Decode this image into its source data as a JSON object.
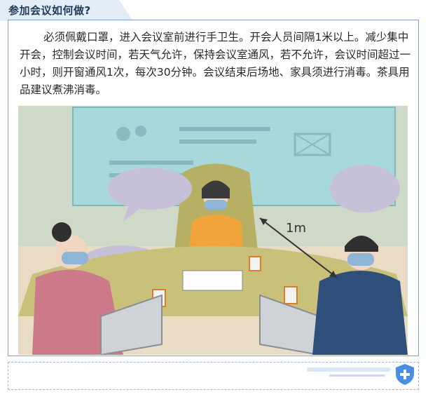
{
  "header": {
    "title": "参加会议如何做?"
  },
  "content": {
    "paragraph": "必须佩戴口罩，进入会议室前进行手卫生。开会人员间隔1米以上。减少集中开会，控制会议时间，若天气允许，保持会议室通风，若不允许，会议时间超过一小时，则开窗通风1次，每次30分钟。会议结束后场地、家具须进行消毒。茶具用品建议煮沸消毒。"
  },
  "illustration": {
    "distance_label": "1m",
    "colors": {
      "wall": "#9fd3d6",
      "table": "#c9c07a",
      "chair": "#b7b064",
      "floor": "#e9dcc4"
    }
  },
  "footer": {
    "icon": "shield-plus-icon"
  }
}
